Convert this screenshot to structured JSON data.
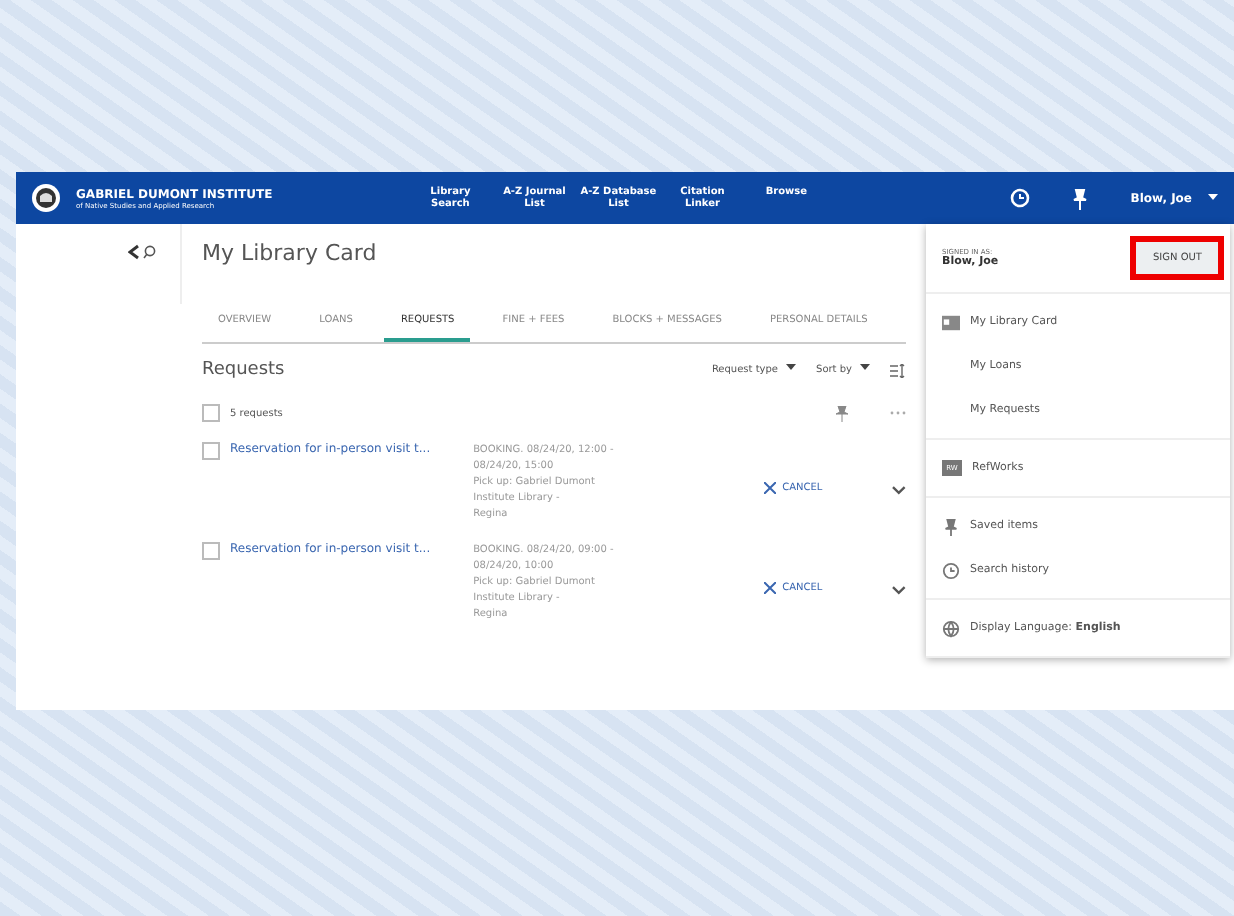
{
  "header": {
    "logo_title": "GABRIEL DUMONT INSTITUTE",
    "logo_subtitle": "of Native Studies and Applied Research",
    "nav": [
      {
        "label": "Library Search"
      },
      {
        "label": "A-Z Journal List"
      },
      {
        "label": "A-Z Database List"
      },
      {
        "label": "Citation Linker"
      },
      {
        "label": "Browse"
      }
    ],
    "user": "Blow, Joe"
  },
  "page": {
    "title": "My Library Card",
    "tabs": [
      {
        "label": "OVERVIEW",
        "selected": false
      },
      {
        "label": "LOANS",
        "selected": false
      },
      {
        "label": "REQUESTS",
        "selected": true
      },
      {
        "label": "FINE + FEES",
        "selected": false
      },
      {
        "label": "BLOCKS + MESSAGES",
        "selected": false
      },
      {
        "label": "PERSONAL DETAILS",
        "selected": false
      }
    ],
    "section": "Requests",
    "filters": [
      {
        "label": "Request type"
      },
      {
        "label": "Sort by"
      }
    ],
    "select_all": {
      "label": "5 requests",
      "checked": false
    },
    "requests": [
      {
        "title": "Reservation for in-person visit t...",
        "checked": false,
        "lines": [
          "BOOKING. 08/24/20, 12:00 -",
          "08/24/20, 15:00",
          "Pick up: Gabriel Dumont",
          "Institute Library -",
          "Regina"
        ],
        "action": "CANCEL"
      },
      {
        "title": "Reservation for in-person visit t...",
        "checked": false,
        "lines": [
          "BOOKING. 08/24/20, 09:00 -",
          "08/24/20, 10:00",
          "Pick up: Gabriel Dumont",
          "Institute Library -",
          "Regina"
        ],
        "action": "CANCEL"
      }
    ]
  },
  "menu": {
    "signed_in_label": "SIGNED IN AS:",
    "user": "Blow, Joe",
    "sign_out": "SIGN OUT",
    "highlighted": true,
    "groups": [
      [
        {
          "kind": "card",
          "label": "My Library Card"
        },
        {
          "kind": "plain",
          "label": "My Loans"
        },
        {
          "kind": "plain",
          "label": "My Requests"
        }
      ],
      [
        {
          "kind": "badge",
          "badge": "RW",
          "label": "RefWorks"
        }
      ],
      [
        {
          "kind": "pin",
          "label": "Saved items"
        },
        {
          "kind": "history",
          "label": "Search history"
        }
      ],
      [
        {
          "kind": "globe",
          "label": "Display Language: **English**"
        }
      ]
    ]
  }
}
